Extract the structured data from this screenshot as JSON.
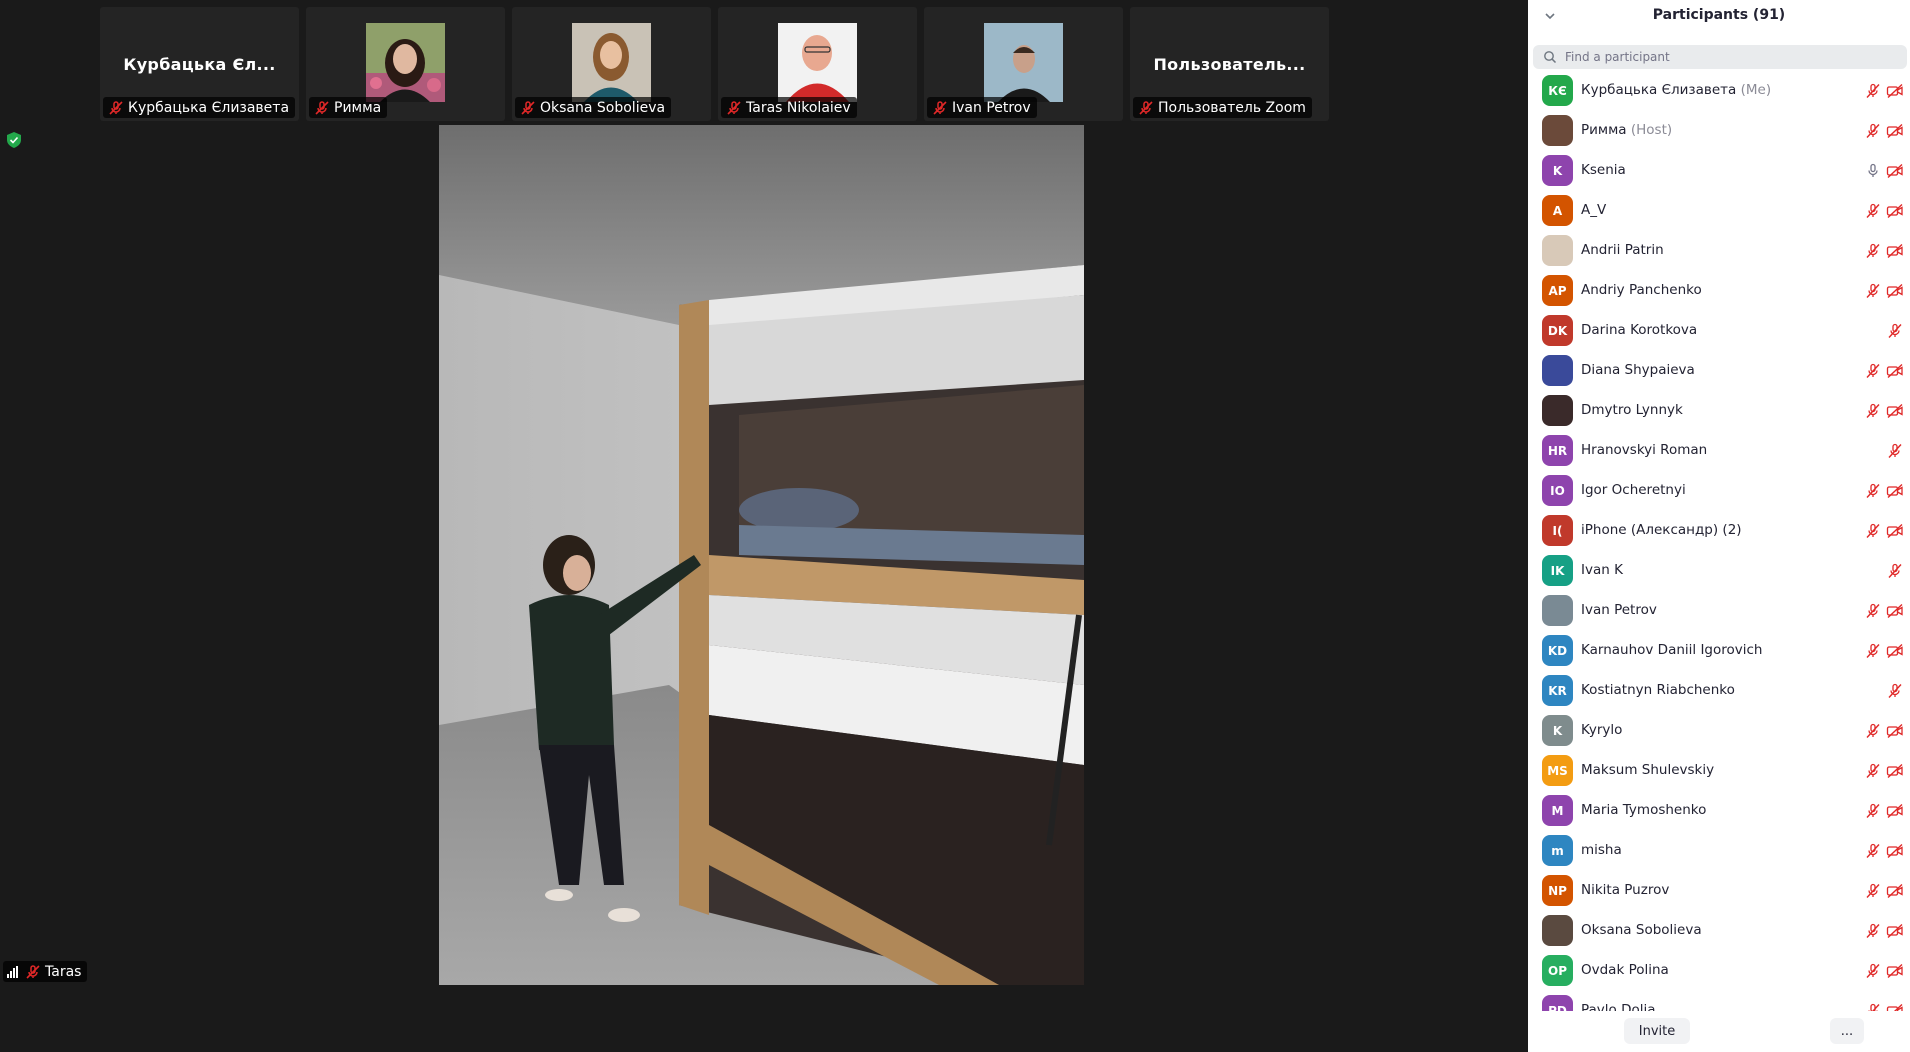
{
  "thumbnails": [
    {
      "big_name": "Курбацька Єл...",
      "label": "Курбацька Єлизавета",
      "has_photo": false
    },
    {
      "big_name": "",
      "label": "Римма",
      "has_photo": true
    },
    {
      "big_name": "",
      "label": "Oksana Sobolieva",
      "has_photo": true
    },
    {
      "big_name": "",
      "label": "Taras Nikolaiev",
      "has_photo": true
    },
    {
      "big_name": "",
      "label": "Ivan Petrov",
      "has_photo": true
    },
    {
      "big_name": "Пользователь...",
      "label": "Пользователь Zoom",
      "has_photo": false
    }
  ],
  "main_video": {
    "speaker_name": "Taras"
  },
  "panel": {
    "title": "Participants (91)",
    "search_placeholder": "Find a participant",
    "invite_label": "Invite",
    "more_label": "..."
  },
  "participants": [
    {
      "initials": "КЄ",
      "color": "#23a84b",
      "name": "Курбацька Єлизавета",
      "role": "(Me)",
      "mic": "muted",
      "video": "off"
    },
    {
      "initials": "",
      "color": "#6b4a3a",
      "name": "Римма",
      "role": "(Host)",
      "mic": "muted",
      "video": "off"
    },
    {
      "initials": "K",
      "color": "#8e44ad",
      "name": "Ksenia",
      "role": "",
      "mic": "on",
      "video": "off"
    },
    {
      "initials": "A",
      "color": "#d35400",
      "name": "A_V",
      "role": "",
      "mic": "muted",
      "video": "off"
    },
    {
      "initials": "",
      "color": "#d8c9b8",
      "name": "Andrii Patrin",
      "role": "",
      "mic": "muted",
      "video": "off"
    },
    {
      "initials": "AP",
      "color": "#d35400",
      "name": "Andriy Panchenko",
      "role": "",
      "mic": "muted",
      "video": "off"
    },
    {
      "initials": "DK",
      "color": "#c0392b",
      "name": "Darina Korotkova",
      "role": "",
      "mic": "muted",
      "video": "none"
    },
    {
      "initials": "",
      "color": "#3a4a9a",
      "name": "Diana Shypaieva",
      "role": "",
      "mic": "muted",
      "video": "off"
    },
    {
      "initials": "",
      "color": "#3a2a2a",
      "name": "Dmytro Lynnyk",
      "role": "",
      "mic": "muted",
      "video": "off"
    },
    {
      "initials": "HR",
      "color": "#8e44ad",
      "name": "Hranovskyi Roman",
      "role": "",
      "mic": "muted",
      "video": "none"
    },
    {
      "initials": "IO",
      "color": "#8e44ad",
      "name": "Igor Ocheretnyi",
      "role": "",
      "mic": "muted",
      "video": "off"
    },
    {
      "initials": "I(",
      "color": "#c0392b",
      "name": "iPhone (Александр) (2)",
      "role": "",
      "mic": "muted",
      "video": "off"
    },
    {
      "initials": "IK",
      "color": "#16a085",
      "name": "Ivan K",
      "role": "",
      "mic": "muted",
      "video": "none"
    },
    {
      "initials": "",
      "color": "#7a8a94",
      "name": "Ivan Petrov",
      "role": "",
      "mic": "muted",
      "video": "off"
    },
    {
      "initials": "KD",
      "color": "#2e86c1",
      "name": "Karnauhov Daniil Igorovich",
      "role": "",
      "mic": "muted",
      "video": "off"
    },
    {
      "initials": "KR",
      "color": "#2e86c1",
      "name": "Kostiatnyn Riabchenko",
      "role": "",
      "mic": "muted",
      "video": "none"
    },
    {
      "initials": "K",
      "color": "#7f8c8d",
      "name": "Kyrylo",
      "role": "",
      "mic": "muted",
      "video": "off"
    },
    {
      "initials": "MS",
      "color": "#f39c12",
      "name": "Maksum Shulevskiy",
      "role": "",
      "mic": "muted",
      "video": "off"
    },
    {
      "initials": "M",
      "color": "#8e44ad",
      "name": "Maria Tymoshenko",
      "role": "",
      "mic": "muted",
      "video": "off"
    },
    {
      "initials": "m",
      "color": "#2e86c1",
      "name": "misha",
      "role": "",
      "mic": "muted",
      "video": "off"
    },
    {
      "initials": "NP",
      "color": "#d35400",
      "name": "Nikita Puzrov",
      "role": "",
      "mic": "muted",
      "video": "off"
    },
    {
      "initials": "",
      "color": "#5a4a40",
      "name": "Oksana Sobolieva",
      "role": "",
      "mic": "muted",
      "video": "off"
    },
    {
      "initials": "OP",
      "color": "#27ae60",
      "name": "Ovdak Polina",
      "role": "",
      "mic": "muted",
      "video": "off"
    },
    {
      "initials": "PD",
      "color": "#8e44ad",
      "name": "Pavlo Dolia",
      "role": "",
      "mic": "muted",
      "video": "off"
    }
  ],
  "colors": {
    "muted_red": "#e02828",
    "panel_bg": "#ffffff",
    "meeting_bg": "#1a1a1a"
  }
}
